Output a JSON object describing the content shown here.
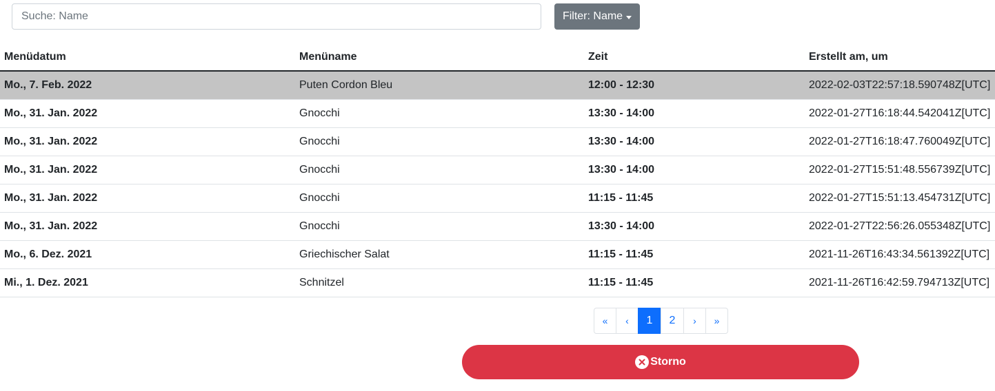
{
  "search": {
    "placeholder": "Suche: Name",
    "value": ""
  },
  "filter": {
    "label": "Filter: Name"
  },
  "table": {
    "headers": [
      "Menüdatum",
      "Menüname",
      "Zeit",
      "Erstellt am, um"
    ],
    "rows": [
      {
        "date": "Mo., 7. Feb. 2022",
        "name": "Puten Cordon Bleu",
        "time": "12:00 - 12:30",
        "created": "2022-02-03T22:57:18.590748Z[UTC]",
        "selected": true
      },
      {
        "date": "Mo., 31. Jan. 2022",
        "name": "Gnocchi",
        "time": "13:30 - 14:00",
        "created": "2022-01-27T16:18:44.542041Z[UTC]",
        "selected": false
      },
      {
        "date": "Mo., 31. Jan. 2022",
        "name": "Gnocchi",
        "time": "13:30 - 14:00",
        "created": "2022-01-27T16:18:47.760049Z[UTC]",
        "selected": false
      },
      {
        "date": "Mo., 31. Jan. 2022",
        "name": "Gnocchi",
        "time": "13:30 - 14:00",
        "created": "2022-01-27T15:51:48.556739Z[UTC]",
        "selected": false
      },
      {
        "date": "Mo., 31. Jan. 2022",
        "name": "Gnocchi",
        "time": "11:15 - 11:45",
        "created": "2022-01-27T15:51:13.454731Z[UTC]",
        "selected": false
      },
      {
        "date": "Mo., 31. Jan. 2022",
        "name": "Gnocchi",
        "time": "13:30 - 14:00",
        "created": "2022-01-27T22:56:26.055348Z[UTC]",
        "selected": false
      },
      {
        "date": "Mo., 6. Dez. 2021",
        "name": "Griechischer Salat",
        "time": "11:15 - 11:45",
        "created": "2021-11-26T16:43:34.561392Z[UTC]",
        "selected": false
      },
      {
        "date": "Mi., 1. Dez. 2021",
        "name": "Schnitzel",
        "time": "11:15 - 11:45",
        "created": "2021-11-26T16:42:59.794713Z[UTC]",
        "selected": false
      }
    ]
  },
  "pagination": {
    "first": "«",
    "prev": "‹",
    "pages": [
      "1",
      "2"
    ],
    "active_page": "1",
    "next": "›",
    "last": "»"
  },
  "actions": {
    "storno_label": "Storno",
    "storno_icon": "x-circle-icon"
  },
  "colors": {
    "primary": "#0d6efd",
    "danger": "#dc3545",
    "secondary": "#6c757d",
    "selected_row": "#c4c4c4"
  }
}
